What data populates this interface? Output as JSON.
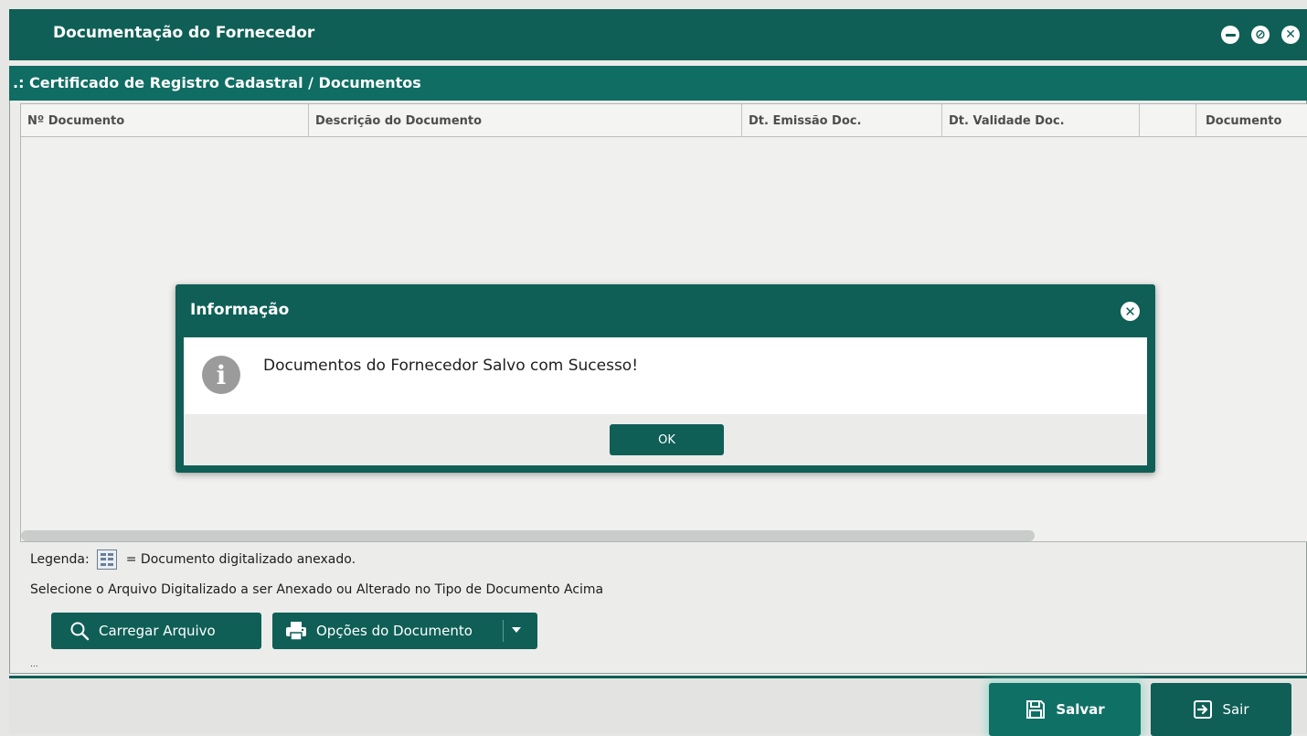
{
  "window": {
    "title": "Documentação do Fornecedor",
    "min_glyph": "",
    "max_glyph": "⊘",
    "close_glyph": "✕"
  },
  "section": {
    "title": ".: Certificado de Registro Cadastral / Documentos"
  },
  "grid": {
    "columns": [
      "Nº Documento",
      "Descrição do Documento",
      "Dt. Emissão Doc.",
      "Dt. Validade Doc.",
      "",
      "Documento"
    ]
  },
  "legend": {
    "label": "Legenda:",
    "icon": "scanned-document-icon",
    "text": "= Documento digitalizado anexado."
  },
  "instruction": "Selecione o Arquivo Digitalizado a ser Anexado ou Alterado no Tipo de Documento Acima",
  "actions": {
    "load_file": "Carregar Arquivo",
    "document_options": "Opções do Documento"
  },
  "footer": {
    "save": "Salvar",
    "exit": "Sair"
  },
  "dialog": {
    "title": "Informação",
    "message": "Documentos do Fornecedor Salvo com Sucesso!",
    "icon_glyph": "i",
    "close_glyph": "✕",
    "ok": "OK"
  },
  "misc": {
    "dots": "..."
  },
  "colors": {
    "primary": "#0f5f56",
    "section": "#0f6d63",
    "save_glow": "#6ed2be"
  }
}
